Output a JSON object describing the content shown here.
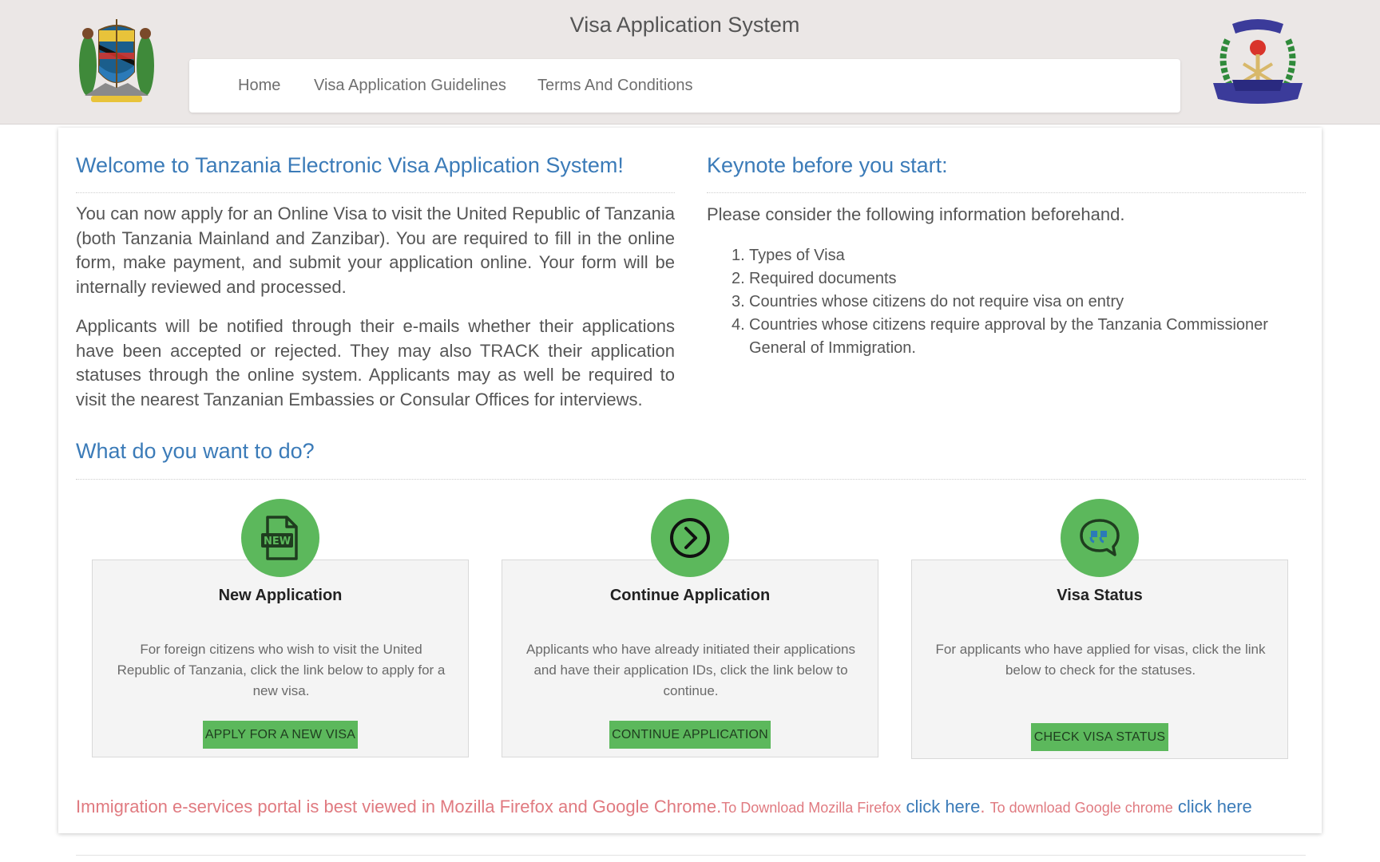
{
  "site": {
    "title": "Visa Application System"
  },
  "nav": {
    "items": [
      {
        "label": "Home"
      },
      {
        "label": "Visa Application Guidelines"
      },
      {
        "label": "Terms And Conditions"
      }
    ]
  },
  "welcome": {
    "heading": "Welcome to Tanzania Electronic Visa Application System!",
    "paragraphs": [
      "You can now apply for an Online Visa to visit the United Republic of Tanzania (both Tanzania Mainland and Zanzibar). You are required to fill in the online form, make payment, and submit your application online. Your form will be internally reviewed and processed.",
      "Applicants will be notified through their e-mails whether their applications have been accepted or rejected. They may also TRACK their application statuses through the online system. Applicants may as well be required to visit the nearest Tanzanian Embassies or Consular Offices for interviews."
    ]
  },
  "keynote": {
    "heading": "Keynote before you start:",
    "intro": "Please consider the following information beforehand.",
    "items": [
      {
        "num": "1.",
        "text": "Types of Visa"
      },
      {
        "num": "2.",
        "text": "Required documents"
      },
      {
        "num": "3.",
        "text": "Countries whose citizens do not require visa on entry"
      },
      {
        "num": "4.",
        "text": "Countries whose citizens require approval by the Tanzania Commissioner General of Immigration."
      }
    ]
  },
  "actions": {
    "heading": "What do you want to do?",
    "cards": [
      {
        "icon": "new-document-icon",
        "title": "New Application",
        "description": "For foreign citizens who wish to visit the United Republic of Tanzania, click the link below to apply for a new visa.",
        "button": "APPLY FOR A NEW VISA"
      },
      {
        "icon": "arrow-right-circle-icon",
        "title": "Continue Application",
        "description": "Applicants who have already initiated their applications and have their application IDs, click the link below to continue.",
        "button": "CONTINUE APPLICATION"
      },
      {
        "icon": "quote-chat-icon",
        "title": "Visa Status",
        "description": "For applicants who have applied for visas, click the link below to check for the statuses.",
        "button": "CHECK VISA STATUS"
      }
    ]
  },
  "browser_note": {
    "main": "Immigration e-services portal is best viewed in Mozilla Firefox and Google Chrome.",
    "firefox_prefix": "To Download Mozilla Firefox",
    "firefox_link": "click here",
    "separator": ".",
    "chrome_prefix": "To download Google chrome",
    "chrome_link": "click here"
  },
  "colors": {
    "header_bg": "#ebe7e6",
    "heading_blue": "#3b7bb8",
    "accent_green": "#5cb85c",
    "note_pink": "#e07a80"
  }
}
